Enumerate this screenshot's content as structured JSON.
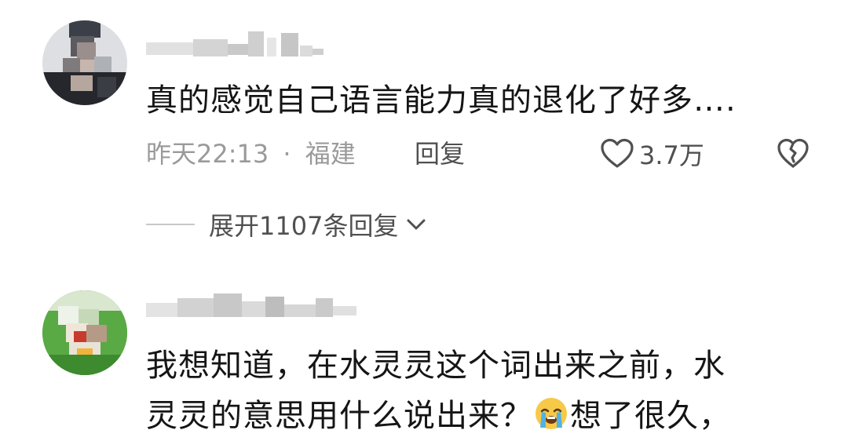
{
  "comments": [
    {
      "text": "真的感觉自己语言能力真的退化了好多….",
      "time": "昨天22:13",
      "separator": "·",
      "location": "福建",
      "reply_label": "回复",
      "like_count": "3.7万",
      "expand_label": "展开1107条回复"
    },
    {
      "text_line1": "我想知道，在水灵灵这个词出来之前，水",
      "text_line2_before_emoji": "灵灵的意思用什么说出来？",
      "emoji": "loudly-crying-face-emoji",
      "text_line2_after_emoji": "想了很久，"
    }
  ],
  "colors": {
    "text_primary": "#151515",
    "text_secondary": "#9a9a9a",
    "action_gray": "#505050",
    "divider": "#c8c8c8",
    "avatar2_green": "#4a9d3c"
  }
}
